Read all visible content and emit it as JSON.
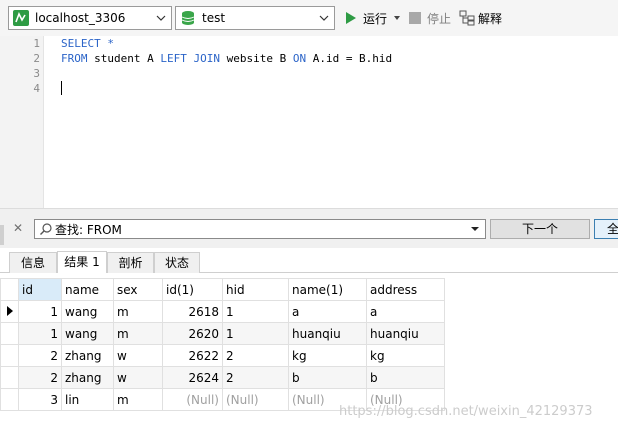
{
  "toolbar": {
    "connection": "localhost_3306",
    "database": "test",
    "run_label": "运行",
    "stop_label": "停止",
    "explain_label": "解释"
  },
  "editor": {
    "line_numbers": [
      "1",
      "2",
      "3",
      "4"
    ],
    "line1_kw": "SELECT *",
    "line2_a": "FROM",
    "line2_b": " student A ",
    "line2_c": "LEFT JOIN",
    "line2_d": " website B ",
    "line2_e": "ON",
    "line2_f": " A.id = B.hid"
  },
  "find": {
    "value": "查找: FROM",
    "next_label": "下一个",
    "all_label": "全"
  },
  "tabs": [
    "信息",
    "结果 1",
    "剖析",
    "状态"
  ],
  "grid": {
    "columns": [
      "id",
      "name",
      "sex",
      "id(1)",
      "hid",
      "name(1)",
      "address"
    ],
    "rows": [
      [
        "1",
        "wang",
        "m",
        "2618",
        "1",
        "a",
        "a"
      ],
      [
        "1",
        "wang",
        "m",
        "2620",
        "1",
        "huanqiu",
        "huanqiu"
      ],
      [
        "2",
        "zhang",
        "w",
        "2622",
        "2",
        "kg",
        "kg"
      ],
      [
        "2",
        "zhang",
        "w",
        "2624",
        "2",
        "b",
        "b"
      ],
      [
        "3",
        "lin",
        "m",
        "(Null)",
        "(Null)",
        "(Null)",
        "(Null)"
      ]
    ]
  },
  "watermark": "https://blog.csdn.net/weixin_42129373"
}
